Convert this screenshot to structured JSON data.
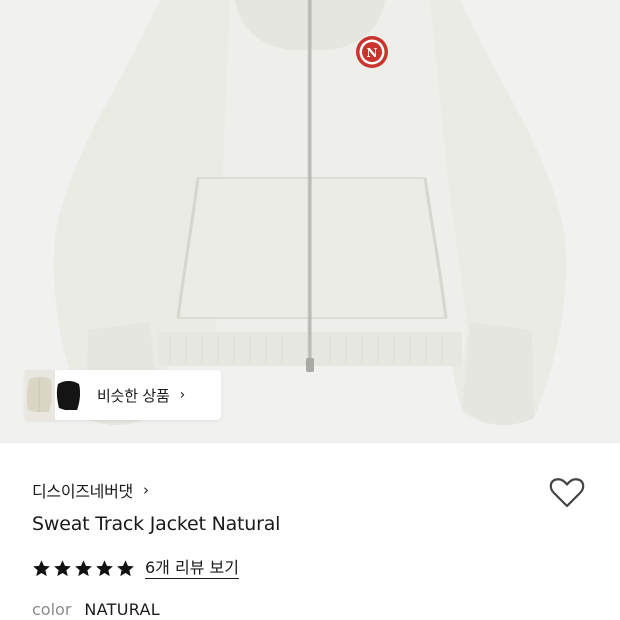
{
  "product_image": {
    "alt": "Sweat Track Jacket Natural"
  },
  "similar_products": {
    "label": "비슷한 상품",
    "chevron": "›"
  },
  "brand": {
    "name": "디스이즈네버댓",
    "chevron": "›"
  },
  "wishlist": {
    "icon": "heart-outline-icon"
  },
  "product": {
    "title": "Sweat Track Jacket Natural"
  },
  "rating": {
    "stars": 5,
    "max_stars": 5,
    "review_link": "6개 리뷰 보기"
  },
  "color": {
    "label": "color",
    "value": "NATURAL"
  },
  "colors": {
    "hero_bg": "#f1f1ef",
    "jacket": "#ebebe6",
    "badge_red": "#c9342c",
    "text": "#1a1a1a",
    "muted": "#8b8b8b"
  }
}
